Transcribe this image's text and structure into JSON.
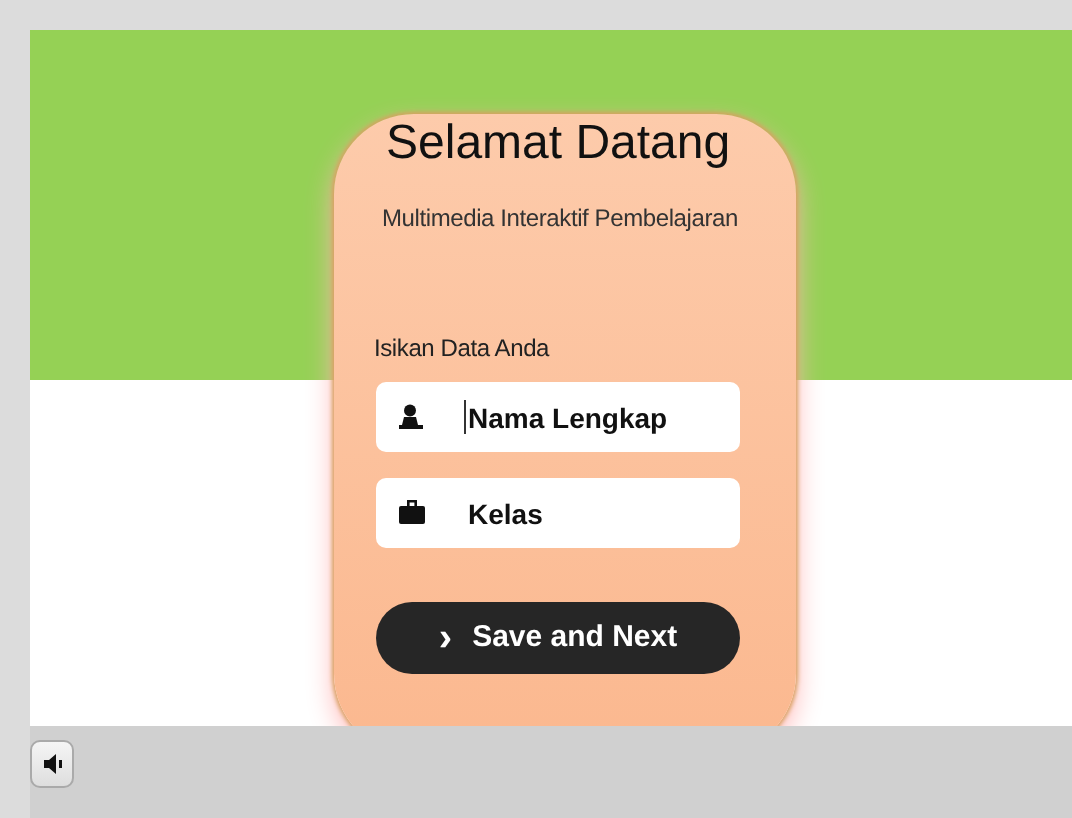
{
  "card": {
    "title": "Selamat Datang",
    "subtitle": "Multimedia Interaktif Pembelajaran",
    "form_label": "Isikan Data Anda",
    "fields": [
      {
        "kind": "person",
        "placeholder": "Nama Lengkap",
        "focused": true
      },
      {
        "kind": "bag",
        "placeholder": "Kelas",
        "focused": false
      }
    ],
    "button": {
      "icon": "›",
      "label": "Save and Next"
    }
  },
  "player": {
    "muted": false
  }
}
